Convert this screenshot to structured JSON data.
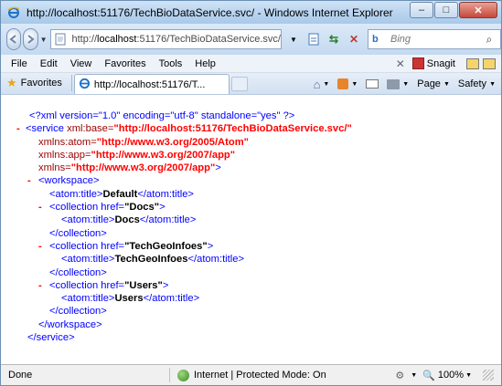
{
  "window": {
    "title": "http://localhost:51176/TechBioDataService.svc/ - Windows Internet Explorer",
    "controls": {
      "minimize": "–",
      "maximize": "□",
      "close": "✕"
    }
  },
  "address": {
    "url_prefix": "http://",
    "url_host": "localhost",
    "url_rest": ":51176/TechBioDataService.svc/"
  },
  "search": {
    "placeholder": "Bing"
  },
  "menu": {
    "items": [
      "File",
      "Edit",
      "View",
      "Favorites",
      "Tools",
      "Help"
    ],
    "snagit_label": "Snagit"
  },
  "favorites": {
    "label": "Favorites",
    "tab_title": "http://localhost:51176/T..."
  },
  "commandbar": {
    "page_label": "Page",
    "safety_label": "Safety"
  },
  "xml": {
    "decl": "<?xml version=\"1.0\" encoding=\"utf-8\" standalone=\"yes\" ?>",
    "service_open": "<service",
    "xmlbase_attr": "xml:base=",
    "xmlbase_val": "\"http://localhost:51176/TechBioDataService.svc/\"",
    "atom_attr": "xmlns:atom=",
    "atom_val": "\"http://www.w3.org/2005/Atom\"",
    "app_attr": "xmlns:app=",
    "app_val": "\"http://www.w3.org/2007/app\"",
    "xmlns_attr": "xmlns=",
    "xmlns_val": "\"http://www.w3.org/2007/app\"",
    "gt": ">",
    "workspace_open": "<workspace>",
    "atom_title_open": "<atom:title>",
    "atom_title_close": "</atom:title>",
    "workspace_title": "Default",
    "collection_open": "<collection href=",
    "collection_close": "</collection>",
    "workspace_close": "</workspace>",
    "service_close": "</service>",
    "minus": "-",
    "collections": [
      {
        "href": "\"Docs\"",
        "title": "Docs"
      },
      {
        "href": "\"TechGeoInfoes\"",
        "title": "TechGeoInfoes"
      },
      {
        "href": "\"Users\"",
        "title": "Users"
      }
    ]
  },
  "status": {
    "left": "Done",
    "zone": "Internet | Protected Mode: On",
    "zoom": "100%"
  }
}
